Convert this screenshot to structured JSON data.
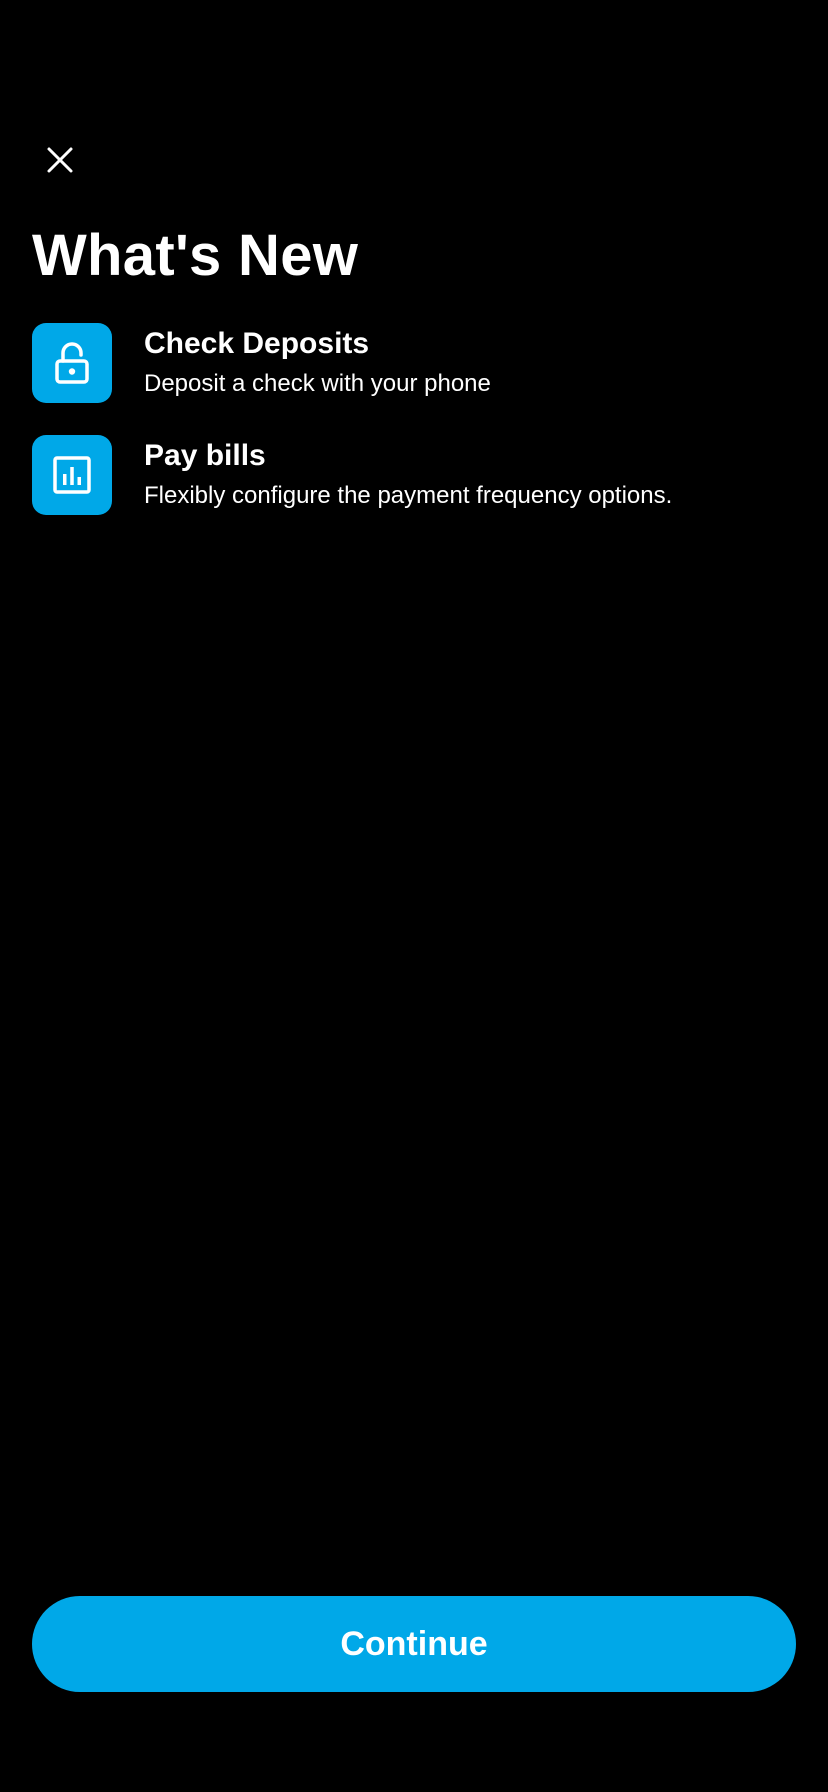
{
  "header": {
    "close_icon": "close-icon"
  },
  "page": {
    "title": "What's New"
  },
  "features": [
    {
      "icon": "unlock-icon",
      "title": "Check Deposits",
      "description": "Deposit a check with your phone"
    },
    {
      "icon": "bar-chart-icon",
      "title": "Pay bills",
      "description": "Flexibly configure the payment frequency options."
    }
  ],
  "footer": {
    "continue_label": "Continue"
  },
  "colors": {
    "background": "#000000",
    "accent": "#00a8e8",
    "text": "#ffffff"
  }
}
